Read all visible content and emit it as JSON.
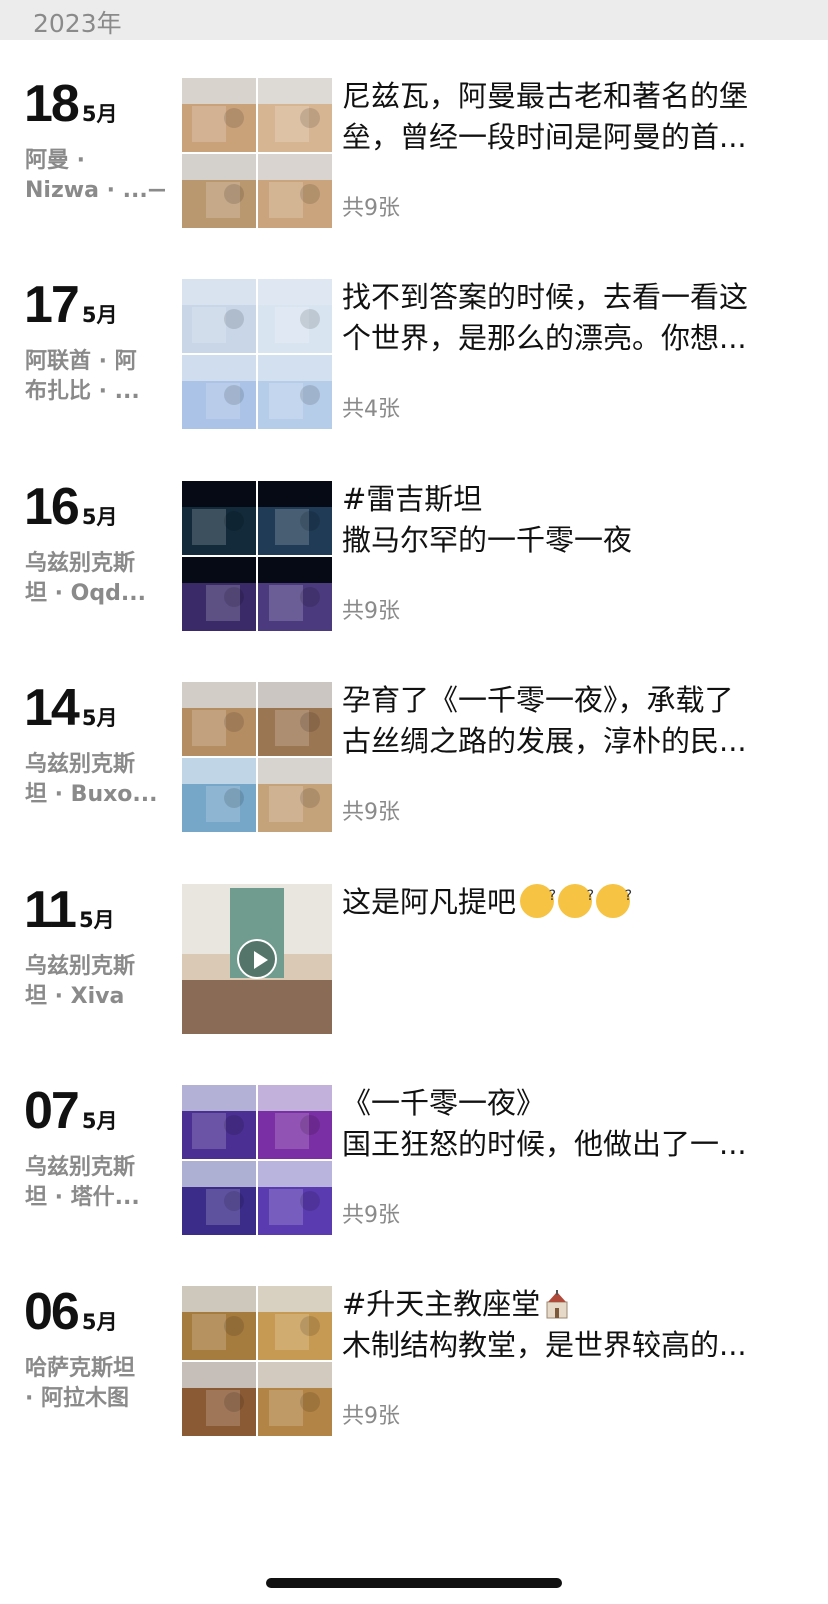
{
  "year_header": "2023年",
  "month_label": "5月",
  "entries": [
    {
      "day": "18",
      "month": "5月",
      "location_lines": [
        "阿曼 ·",
        "Nizwa · ...⟶"
      ],
      "text_lines": [
        "尼兹瓦，阿曼最古老和著名的堡",
        "垒，曾经一段时间是阿曼的首..."
      ],
      "count": "共9张",
      "thumbs": "grid",
      "palette": [
        "#c9a27a",
        "#d6b592",
        "#b9976f",
        "#caa47c"
      ]
    },
    {
      "day": "17",
      "month": "5月",
      "location_lines": [
        "阿联酋 · 阿",
        "布扎比 · ..."
      ],
      "text_lines": [
        "找不到答案的时候，去看一看这",
        "个世界，是那么的漂亮。你想..."
      ],
      "count": "共4张",
      "thumbs": "grid",
      "palette": [
        "#c8d6e8",
        "#d9e4f1",
        "#aac3e6",
        "#b6cde9"
      ]
    },
    {
      "day": "16",
      "month": "5月",
      "location_lines": [
        "乌兹别克斯",
        "坦 · Oqd..."
      ],
      "text_lines": [
        "#雷吉斯坦",
        "撒马尔罕的一千零一夜"
      ],
      "count": "共9张",
      "thumbs": "grid",
      "palette": [
        "#122a3a",
        "#1f3b55",
        "#3a2a68",
        "#4b3a7e"
      ]
    },
    {
      "day": "14",
      "month": "5月",
      "location_lines": [
        "乌兹别克斯",
        "坦 · Buxo..."
      ],
      "text_lines": [
        "孕育了《一千零一夜》，承载了",
        "古丝绸之路的发展，淳朴的民..."
      ],
      "count": "共9张",
      "thumbs": "grid",
      "palette": [
        "#b58d63",
        "#9b7652",
        "#76a7c8",
        "#c4a27a"
      ]
    },
    {
      "day": "11",
      "month": "5月",
      "location_lines": [
        "乌兹别克斯",
        "坦 · Xiva"
      ],
      "text_lines": [
        "这是阿凡提吧"
      ],
      "count": "",
      "thumbs": "video",
      "palette": [
        "#d8c7b2",
        "#7b9b86",
        "#e9e2d6",
        "#b08c6c"
      ]
    },
    {
      "day": "07",
      "month": "5月",
      "location_lines": [
        "乌兹别克斯",
        "坦 · 塔什..."
      ],
      "text_lines": [
        "《一千零一夜》",
        "国王狂怒的时候，他做出了一..."
      ],
      "count": "共9张",
      "thumbs": "grid",
      "palette": [
        "#4b2f92",
        "#7a2fa4",
        "#3b2c8a",
        "#5a3bb0"
      ]
    },
    {
      "day": "06",
      "month": "5月",
      "location_lines": [
        "哈萨克斯坦",
        "· 阿拉木图"
      ],
      "text_lines": [
        "#升天主教座堂",
        "木制结构教堂，是世界较高的..."
      ],
      "count": "共9张",
      "thumbs": "grid",
      "palette": [
        "#a57b3e",
        "#c69a52",
        "#8a5a34",
        "#b28445"
      ]
    }
  ],
  "icons": {
    "play": "play-icon",
    "emoji": "face-emoji-icon",
    "church": "church-icon"
  }
}
